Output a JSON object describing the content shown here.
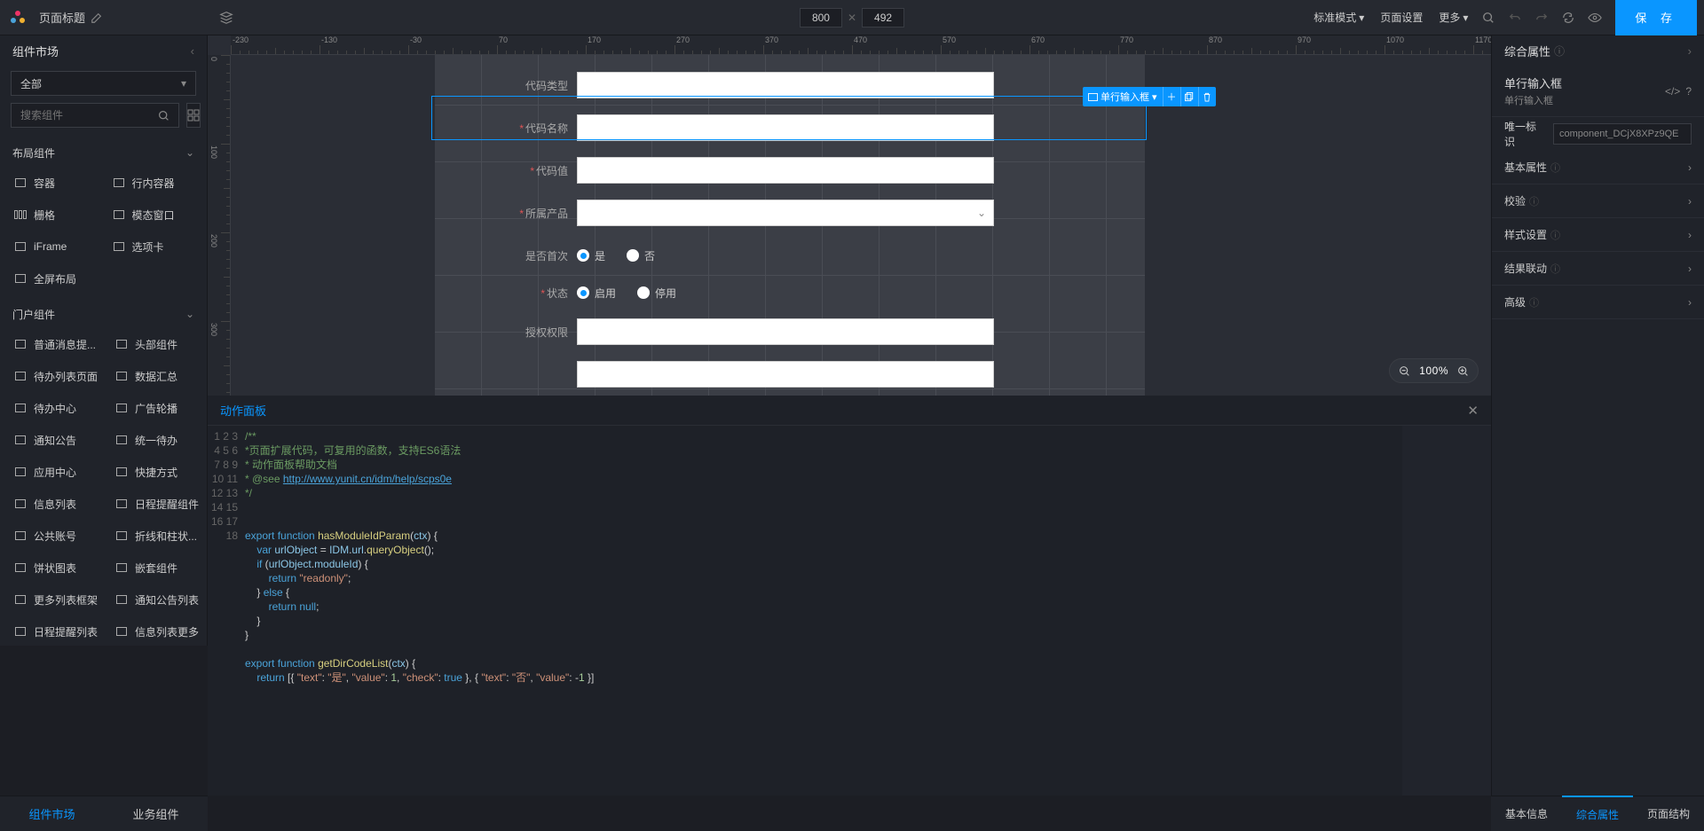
{
  "topbar": {
    "title": "页面标题",
    "width": "800",
    "height": "492",
    "mode": "标准模式",
    "page_settings": "页面设置",
    "more": "更多",
    "save": "保 存"
  },
  "left": {
    "header": "组件市场",
    "category_all": "全部",
    "search_ph": "搜索组件",
    "group_layout": "布局组件",
    "layout_items": [
      "容器",
      "行内容器",
      "栅格",
      "模态窗口",
      "iFrame",
      "选项卡",
      "全屏布局"
    ],
    "group_portal": "门户组件",
    "portal_items": [
      "普通消息提...",
      "头部组件",
      "待办列表页面",
      "数据汇总",
      "待办中心",
      "广告轮播",
      "通知公告",
      "统一待办",
      "应用中心",
      "快捷方式",
      "信息列表",
      "日程提醒组件",
      "公共账号",
      "折线和柱状...",
      "饼状图表",
      "嵌套组件",
      "更多列表框架",
      "通知公告列表",
      "日程提醒列表",
      "信息列表更多"
    ],
    "bottom_tabs": [
      "组件市场",
      "业务组件"
    ]
  },
  "canvas": {
    "selected_tag": "单行输入框",
    "zoom": "100%",
    "form": {
      "row1_label": "代码类型",
      "row2_label": "代码名称",
      "row3_label": "代码值",
      "row4_label": "所属产品",
      "row5_label": "是否首次",
      "row5_opts": [
        "是",
        "否"
      ],
      "row6_label": "状态",
      "row6_opts": [
        "启用",
        "停用"
      ],
      "row7_label": "授权权限"
    }
  },
  "action": {
    "title": "动作面板",
    "code_lines": [
      "/**",
      "*页面扩展代码，可复用的函数，支持ES6语法",
      "* 动作面板帮助文档",
      "* @see http://www.yunit.cn/idm/help/scps0e",
      "*/",
      "",
      "",
      "export function hasModuleIdParam(ctx) {",
      "    var urlObject = IDM.url.queryObject();",
      "    if (urlObject.moduleId) {",
      "        return \"readonly\";",
      "    } else {",
      "        return null;",
      "    }",
      "}",
      "",
      "export function getDirCodeList(ctx) {",
      "    return [{ \"text\": \"是\", \"value\": 1, \"check\": true }, { \"text\": \"否\", \"value\": -1 }]"
    ]
  },
  "right": {
    "header": "综合属性",
    "comp_name": "单行输入框",
    "comp_type": "单行输入框",
    "id_label": "唯一标识",
    "id_value": "component_DCjX8XPz9QE",
    "sections": [
      "基本属性",
      "校验",
      "样式设置",
      "结果联动",
      "高级"
    ],
    "bottom_tabs": [
      "基本信息",
      "综合属性",
      "页面结构"
    ]
  }
}
